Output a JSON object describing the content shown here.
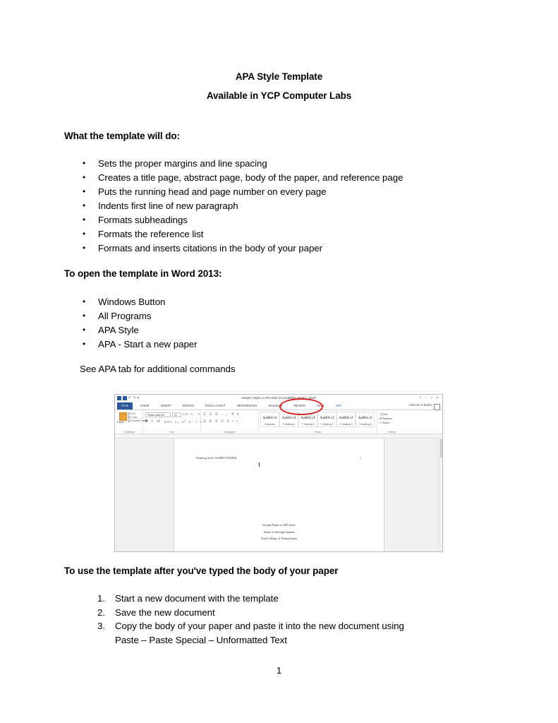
{
  "document": {
    "title_line1": "APA Style Template",
    "title_line2": "Available in YCP Computer Labs",
    "heading_capabilities": "What the template will do:",
    "capabilities": [
      "Sets the proper margins and line spacing",
      "Creates a title page, abstract page, body of the paper, and reference page",
      "Puts the running head and page number on every page",
      "Indents first line of new paragraph",
      "Formats subheadings",
      "Formats the reference list",
      "Formats and inserts citations in the body of your paper"
    ],
    "heading_open": "To open the template in Word 2013:",
    "open_steps": [
      "Windows Button",
      "All Programs",
      "APA Style",
      "APA -  Start a new paper"
    ],
    "note": "See APA tab for additional commands",
    "heading_use": "To use the template after you've typed the body of your paper",
    "use_steps": [
      {
        "num": "1.",
        "line1": "Start a new document with the template",
        "line2": ""
      },
      {
        "num": "2.",
        "line1": "Save the new document",
        "line2": ""
      },
      {
        "num": "3.",
        "line1": "Copy the body of your paper and paste it into the new document using",
        "line2": "Paste – Paste Special – Unformatted Text"
      }
    ],
    "page_number": "1"
  },
  "screenshot": {
    "title_bar": {
      "document_title": "Sample Paper in APA Style [Compatibility Mode] - Word",
      "window_buttons": "? − □ ✕",
      "user_name": "Deborah D Barber"
    },
    "ribbon_tabs": [
      "FILE",
      "HOME",
      "INSERT",
      "DESIGN",
      "PAGE LAYOUT",
      "REFERENCES",
      "MAILINGS",
      "REVIEW",
      "VIEW",
      "APA"
    ],
    "active_tab": "APA",
    "circled_tab": "APA",
    "groups": {
      "clipboard": {
        "label": "Clipboard",
        "paste": "Paste",
        "commands": [
          "Cut",
          "Copy",
          "Format Painter"
        ]
      },
      "font": {
        "label": "Font",
        "font_name": "Times New Ro",
        "font_size": "12",
        "buttons": "B  I  U"
      },
      "paragraph": {
        "label": "Paragraph"
      },
      "styles": {
        "label": "Styles",
        "items": [
          {
            "sample": "AaBbCcI",
            "name": "Emphasis"
          },
          {
            "sample": "AaBbCcI",
            "name": "? Heading 1"
          },
          {
            "sample": "AaBbCcI",
            "name": "? Heading 2"
          },
          {
            "sample": "AaBbCcI",
            "name": "? Heading 3"
          },
          {
            "sample": "AaBbCcI",
            "name": "? Heading 4"
          },
          {
            "sample": "AaBbCcI",
            "name": "? Heading 5"
          }
        ]
      },
      "editing": {
        "label": "Editing",
        "commands": [
          "Find",
          "Replace",
          "Select"
        ]
      }
    },
    "document_page": {
      "running_head": "Running head: SAMPLE PAPER",
      "page_number": "1",
      "center_lines": [
        "Sample Paper in APA Style",
        "Name of Nursing Student",
        "York College of Pennsylvania"
      ]
    },
    "annotation_color": "#d21f1f"
  }
}
